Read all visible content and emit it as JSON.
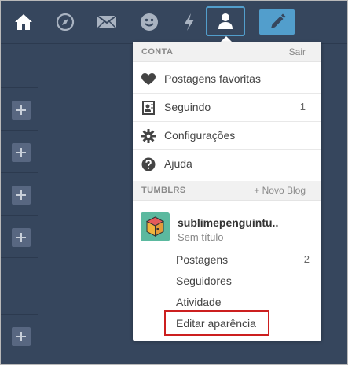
{
  "topnav": {
    "icons": [
      "home-icon",
      "compass-icon",
      "mail-icon",
      "smiley-icon",
      "lightning-icon",
      "account-icon",
      "compose-icon"
    ]
  },
  "menu": {
    "account_header": {
      "title": "CONTA",
      "action": "Sair"
    },
    "account_items": [
      {
        "label": "Postagens favoritas",
        "icon": "heart-icon",
        "count": ""
      },
      {
        "label": "Seguindo",
        "icon": "following-icon",
        "count": "1"
      },
      {
        "label": "Configurações",
        "icon": "gear-icon",
        "count": ""
      },
      {
        "label": "Ajuda",
        "icon": "help-icon",
        "count": ""
      }
    ],
    "tumblrs_header": {
      "title": "TUMBLRS",
      "action": "+ Novo Blog"
    },
    "blog": {
      "name": "sublimepenguintu..",
      "subtitle": "Sem título",
      "items": [
        {
          "label": "Postagens",
          "count": "2"
        },
        {
          "label": "Seguidores",
          "count": ""
        },
        {
          "label": "Atividade",
          "count": ""
        },
        {
          "label": "Editar aparência",
          "count": ""
        }
      ]
    }
  },
  "colors": {
    "background": "#36465d",
    "compose": "#529ecc",
    "highlight": "#cc1f1f"
  }
}
